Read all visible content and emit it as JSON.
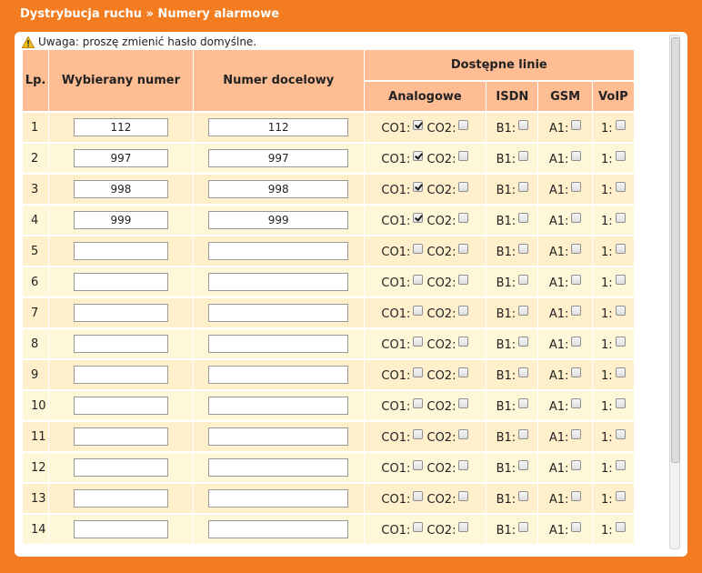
{
  "header": {
    "title": "Dystrybucja ruchu » Numery alarmowe"
  },
  "warning": {
    "text": "Uwaga: proszę zmienić hasło domyślne.",
    "icon": "warning-icon"
  },
  "table": {
    "headers": {
      "lp": "Lp.",
      "dialed": "Wybierany numer",
      "target": "Numer docelowy",
      "lines": "Dostępne linie",
      "analog": "Analogowe",
      "isdn": "ISDN",
      "gsm": "GSM",
      "voip": "VoIP"
    },
    "labels": {
      "co1": "CO1:",
      "co2": "CO2:",
      "b1": "B1:",
      "a1": "A1:",
      "voip1": "1:"
    },
    "rows": [
      {
        "lp": "1",
        "dialed": "112",
        "target": "112",
        "co1": true,
        "co2": false,
        "b1": false,
        "a1": false,
        "voip1": false
      },
      {
        "lp": "2",
        "dialed": "997",
        "target": "997",
        "co1": true,
        "co2": false,
        "b1": false,
        "a1": false,
        "voip1": false
      },
      {
        "lp": "3",
        "dialed": "998",
        "target": "998",
        "co1": true,
        "co2": false,
        "b1": false,
        "a1": false,
        "voip1": false
      },
      {
        "lp": "4",
        "dialed": "999",
        "target": "999",
        "co1": true,
        "co2": false,
        "b1": false,
        "a1": false,
        "voip1": false
      },
      {
        "lp": "5",
        "dialed": "",
        "target": "",
        "co1": false,
        "co2": false,
        "b1": false,
        "a1": false,
        "voip1": false
      },
      {
        "lp": "6",
        "dialed": "",
        "target": "",
        "co1": false,
        "co2": false,
        "b1": false,
        "a1": false,
        "voip1": false
      },
      {
        "lp": "7",
        "dialed": "",
        "target": "",
        "co1": false,
        "co2": false,
        "b1": false,
        "a1": false,
        "voip1": false
      },
      {
        "lp": "8",
        "dialed": "",
        "target": "",
        "co1": false,
        "co2": false,
        "b1": false,
        "a1": false,
        "voip1": false
      },
      {
        "lp": "9",
        "dialed": "",
        "target": "",
        "co1": false,
        "co2": false,
        "b1": false,
        "a1": false,
        "voip1": false
      },
      {
        "lp": "10",
        "dialed": "",
        "target": "",
        "co1": false,
        "co2": false,
        "b1": false,
        "a1": false,
        "voip1": false
      },
      {
        "lp": "11",
        "dialed": "",
        "target": "",
        "co1": false,
        "co2": false,
        "b1": false,
        "a1": false,
        "voip1": false
      },
      {
        "lp": "12",
        "dialed": "",
        "target": "",
        "co1": false,
        "co2": false,
        "b1": false,
        "a1": false,
        "voip1": false
      },
      {
        "lp": "13",
        "dialed": "",
        "target": "",
        "co1": false,
        "co2": false,
        "b1": false,
        "a1": false,
        "voip1": false
      },
      {
        "lp": "14",
        "dialed": "",
        "target": "",
        "co1": false,
        "co2": false,
        "b1": false,
        "a1": false,
        "voip1": false
      }
    ]
  },
  "colors": {
    "frame": "#f47c20",
    "header_cell": "#ffbd94",
    "row_odd": "#ffefcb",
    "row_even": "#fff8d8"
  }
}
